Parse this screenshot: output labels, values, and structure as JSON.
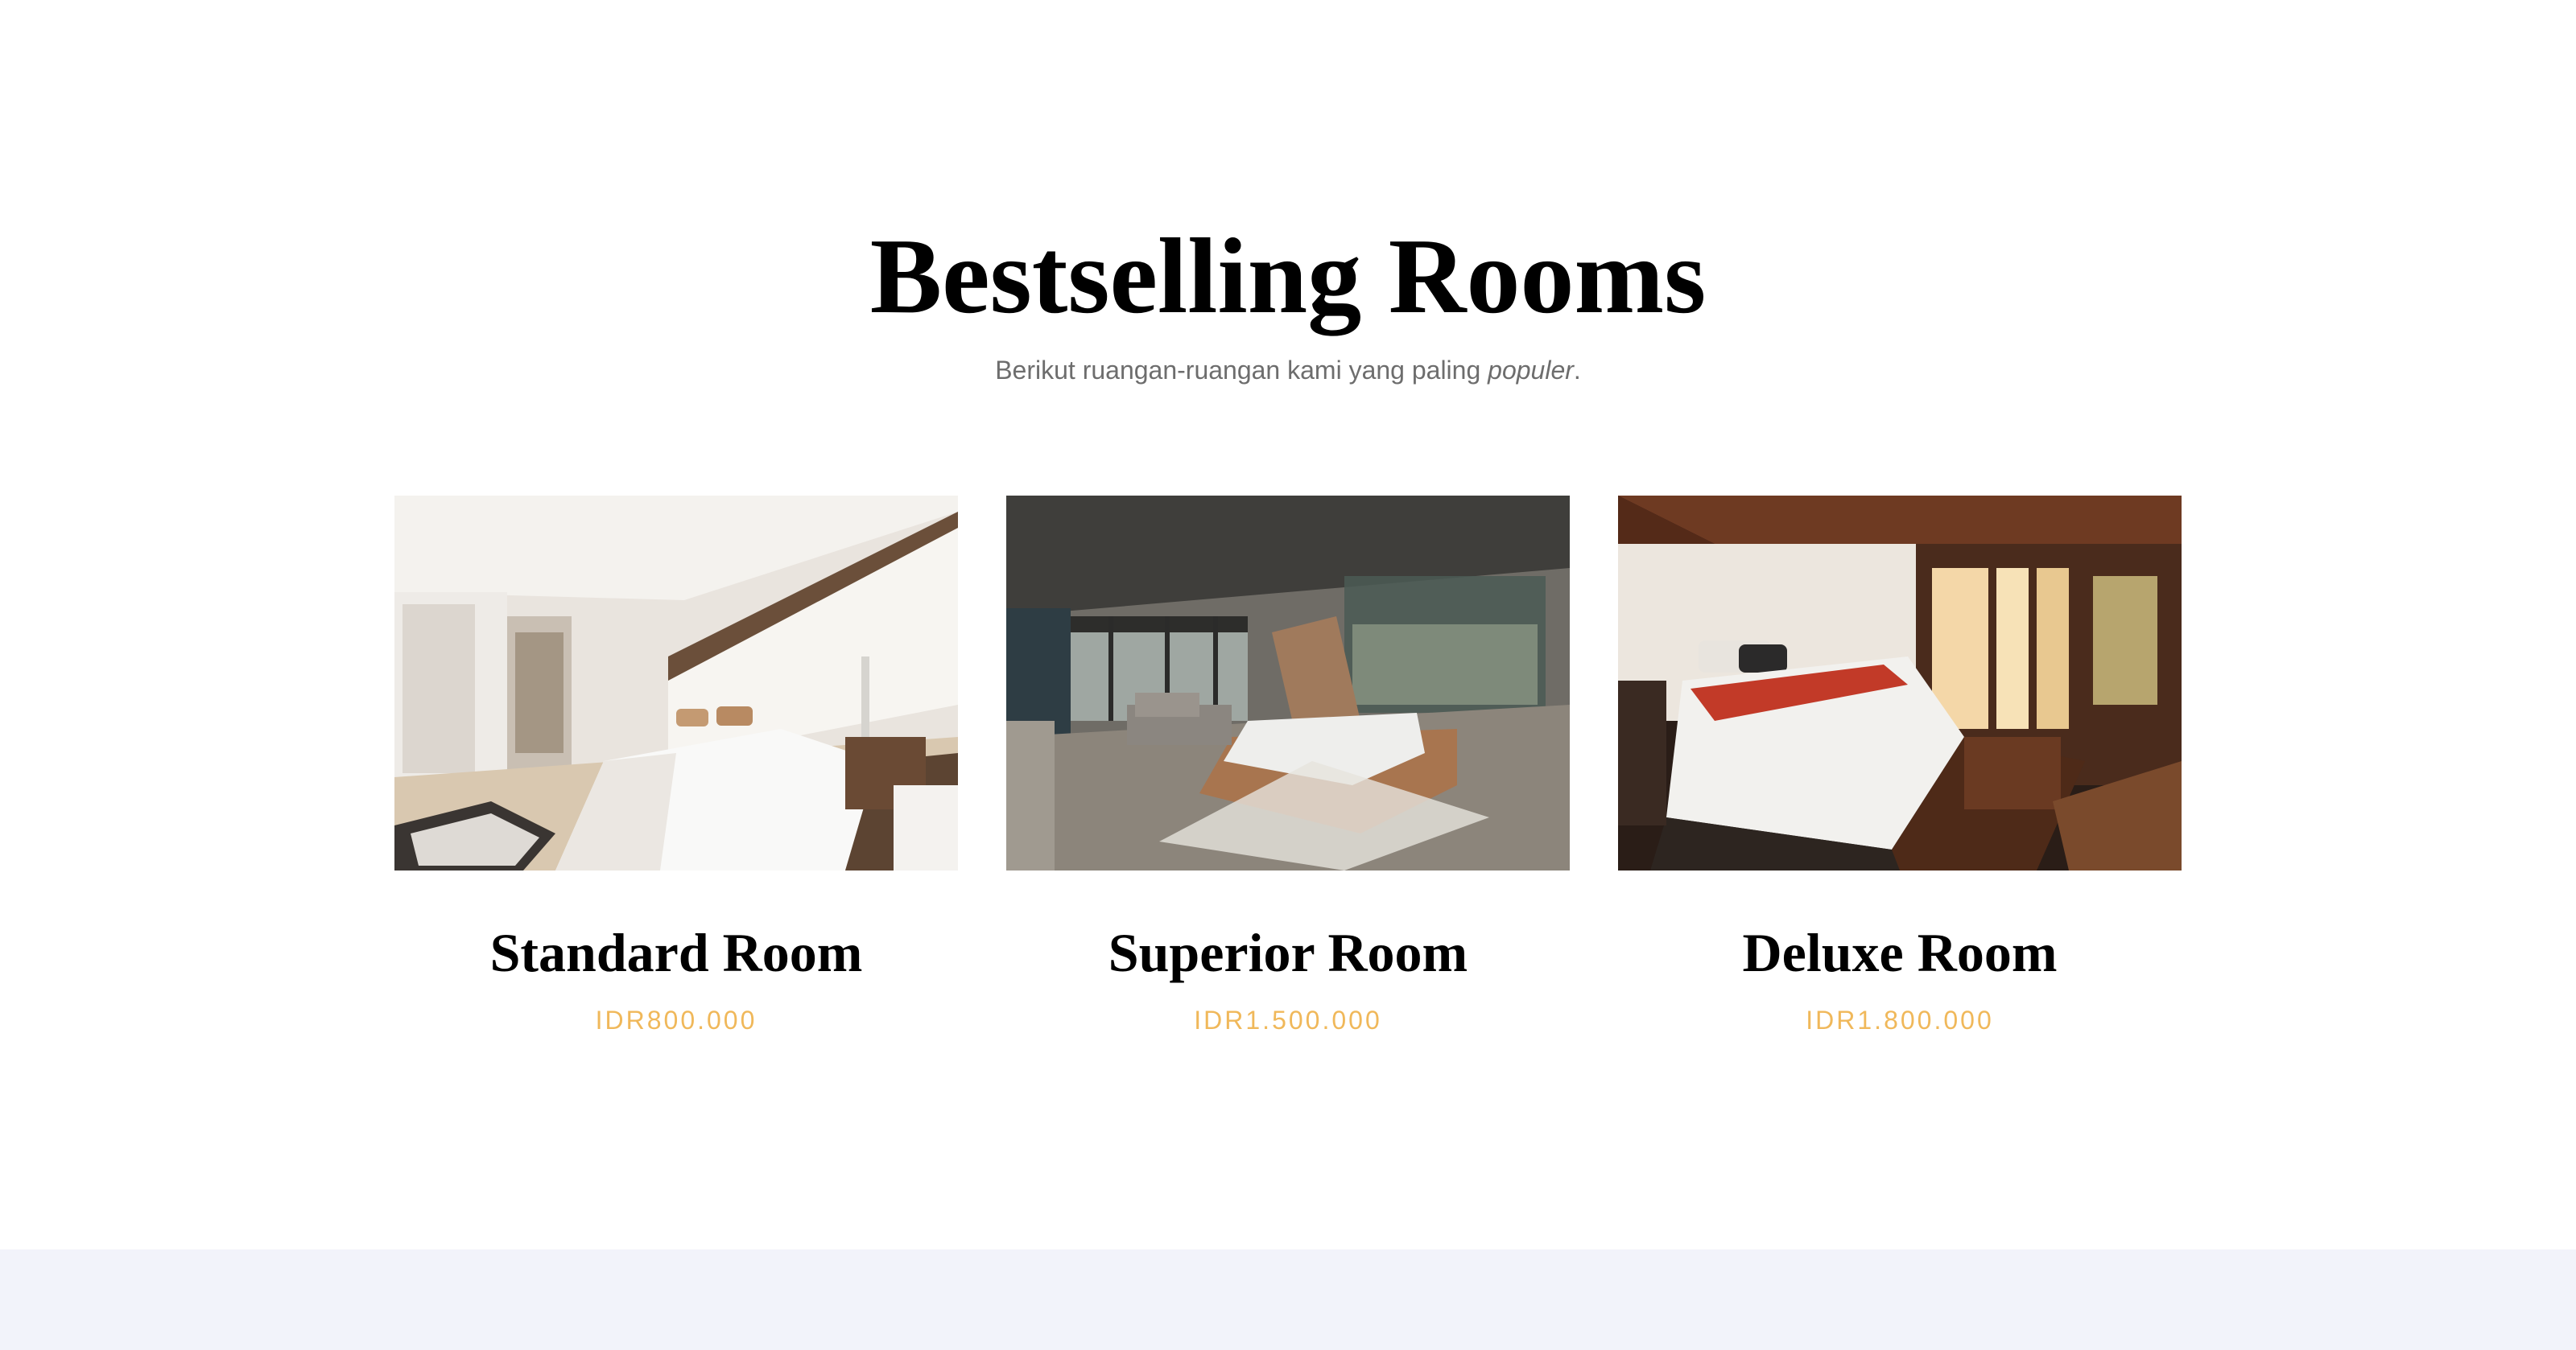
{
  "section": {
    "title": "Bestselling Rooms",
    "subtitle_prefix": "Berikut ruangan-ruangan kami yang paling ",
    "subtitle_emphasis": "populer",
    "subtitle_suffix": "."
  },
  "rooms": [
    {
      "name": "Standard Room",
      "price": "IDR800.000",
      "image": "bright-white-bedroom-photo"
    },
    {
      "name": "Superior Room",
      "price": "IDR1.500.000",
      "image": "glass-wall-loft-bedroom-photo"
    },
    {
      "name": "Deluxe Room",
      "price": "IDR1.800.000",
      "image": "wooden-sunset-bedroom-photo"
    }
  ],
  "colors": {
    "price": "#f0b85a",
    "subtitle": "#6d6d6d",
    "footer_band": "#f2f3fa"
  }
}
